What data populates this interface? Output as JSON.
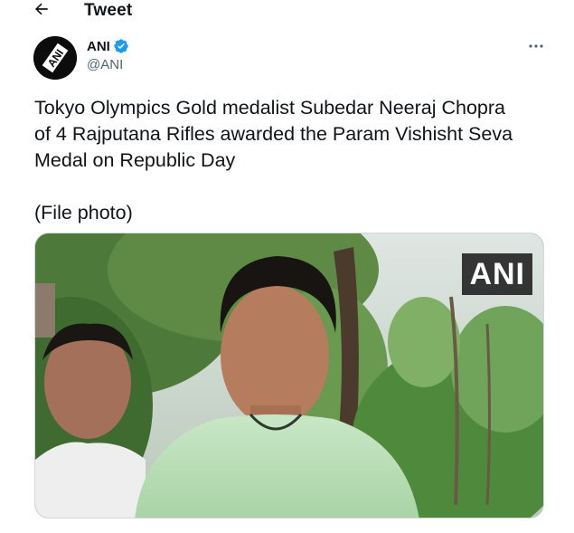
{
  "header": {
    "title": "Tweet",
    "back_icon": "arrow-left-icon"
  },
  "tweet": {
    "author": {
      "name": "ANI",
      "handle": "@ANI",
      "verified": true,
      "avatar_logo_text": "ANI"
    },
    "more_icon": "more-horizontal-icon",
    "text_lines": [
      "Tokyo Olympics Gold medalist Subedar Neeraj Chopra",
      "of 4 Rajputana Rifles awarded the Param Vishisht Seva",
      "Medal on Republic Day"
    ],
    "text_note": "(File photo)",
    "media": {
      "watermark": "ANI"
    }
  },
  "colors": {
    "text": "#0f1419",
    "secondary": "#536471",
    "verified_blue": "#1d9bf0",
    "border": "#cfd9de"
  }
}
